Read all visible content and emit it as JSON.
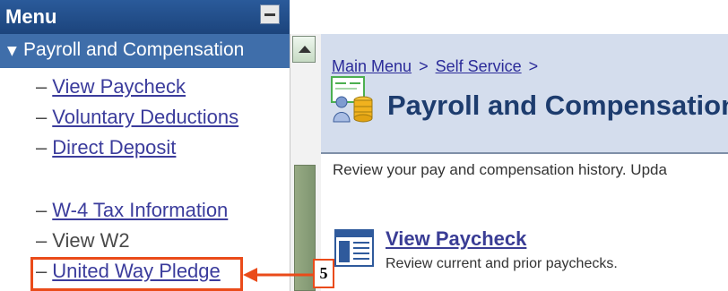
{
  "menu": {
    "title": "Menu",
    "section": {
      "arrow": "▼",
      "label": "Payroll and Compensation"
    },
    "items": [
      {
        "label": "View Paycheck",
        "link": true
      },
      {
        "label": "Voluntary Deductions",
        "link": true
      },
      {
        "label": "Direct Deposit",
        "link": true
      },
      {
        "label": "W-4 Tax Information",
        "link": true
      },
      {
        "label": "View W2",
        "link": false
      },
      {
        "label": "United Way Pledge",
        "link": true
      }
    ],
    "dash": "–"
  },
  "content": {
    "breadcrumb": {
      "main": "Main Menu",
      "sep": ">",
      "self_service": "Self Service",
      "trailing": ">"
    },
    "title": "Payroll and Compensation",
    "description": "Review your pay and compensation history. Upda",
    "item": {
      "title": "View Paycheck",
      "description": "Review current and prior paychecks."
    }
  },
  "annotation": {
    "step": "5"
  },
  "colors": {
    "highlight": "#ea4b1a",
    "header": "#1c447c",
    "link": "#3b3c9c"
  }
}
